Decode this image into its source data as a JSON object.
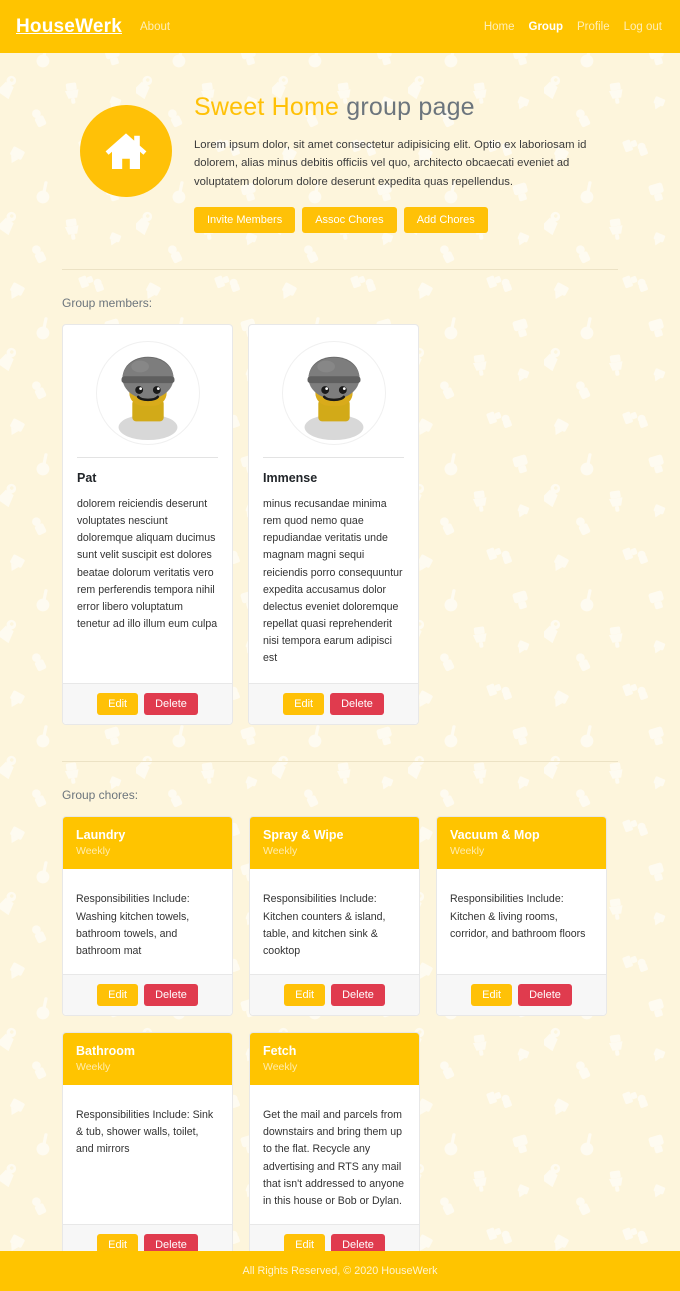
{
  "navbar": {
    "brand": "HouseWerk",
    "left_links": [
      {
        "label": "About",
        "active": false
      }
    ],
    "right_links": [
      {
        "label": "Home",
        "active": false
      },
      {
        "label": "Group",
        "active": true
      },
      {
        "label": "Profile",
        "active": false
      },
      {
        "label": "Log out",
        "active": false
      }
    ]
  },
  "hero": {
    "badge_icon": "home-icon",
    "title_accent": "Sweet Home",
    "title_rest": " group page",
    "description": "Lorem ipsum dolor, sit amet consectetur adipisicing elit. Optio ex laboriosam id dolorem, alias minus debitis officiis vel quo, architecto obcaecati eveniet ad voluptatem dolorum dolore deserunt expedita quas repellendus.",
    "actions": [
      {
        "label": "Invite Members"
      },
      {
        "label": "Assoc Chores"
      },
      {
        "label": "Add Chores"
      }
    ]
  },
  "members_section": {
    "label": "Group members:",
    "members": [
      {
        "name": "Pat",
        "avatar_icon": "lego-minifigure-avatar",
        "bio": "dolorem reiciendis deserunt voluptates nesciunt doloremque aliquam ducimus sunt velit suscipit est dolores beatae dolorum veritatis vero rem perferendis tempora nihil error libero voluptatum tenetur ad illo illum eum culpa",
        "edit_label": "Edit",
        "delete_label": "Delete"
      },
      {
        "name": "Immense",
        "avatar_icon": "lego-minifigure-avatar",
        "bio": "minus recusandae minima rem quod nemo quae repudiandae veritatis unde magnam magni sequi reiciendis porro consequuntur expedita accusamus dolor delectus eveniet doloremque repellat quasi reprehenderit nisi tempora earum adipisci est",
        "edit_label": "Edit",
        "delete_label": "Delete"
      }
    ]
  },
  "chores_section": {
    "label": "Group chores:",
    "chores": [
      {
        "name": "Laundry",
        "frequency": "Weekly",
        "description": "Responsibilities Include: Washing kitchen towels, bathroom towels, and bathroom mat",
        "edit_label": "Edit",
        "delete_label": "Delete"
      },
      {
        "name": "Spray & Wipe",
        "frequency": "Weekly",
        "description": "Responsibilities Include: Kitchen counters & island, table, and kitchen sink & cooktop",
        "edit_label": "Edit",
        "delete_label": "Delete"
      },
      {
        "name": "Vacuum & Mop",
        "frequency": "Weekly",
        "description": "Responsibilities Include: Kitchen & living rooms, corridor, and bathroom floors",
        "edit_label": "Edit",
        "delete_label": "Delete"
      },
      {
        "name": "Bathroom",
        "frequency": "Weekly",
        "description": "Responsibilities Include: Sink & tub, shower walls, toilet, and mirrors",
        "edit_label": "Edit",
        "delete_label": "Delete"
      },
      {
        "name": "Fetch",
        "frequency": "Weekly",
        "description": "Get the mail and parcels from downstairs and bring them up to the flat. Recycle any advertising and RTS any mail that isn't addressed to anyone in this house or Bob or Dylan.",
        "edit_label": "Edit",
        "delete_label": "Delete"
      }
    ]
  },
  "footer": {
    "text": "All Rights Reserved, © 2020 HouseWerk"
  },
  "colors": {
    "brand_yellow": "#ffc400",
    "accent_amber": "#ffc107",
    "danger_red": "#e03b4e",
    "page_background": "#fdf5dc",
    "muted_gray": "#6c757d"
  }
}
